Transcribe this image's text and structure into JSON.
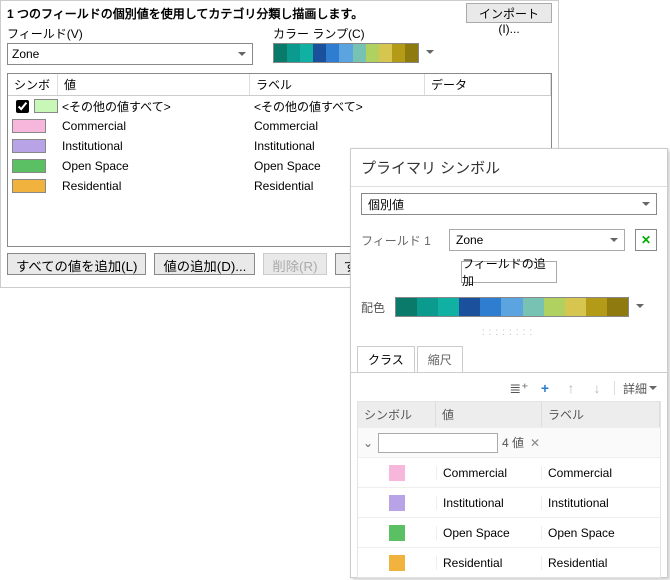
{
  "main": {
    "description": "1 つのフィールドの個別値を使用してカテゴリ分類し描画します。",
    "import_btn": "インポート(I)...",
    "field_label": "フィールド(V)",
    "field_value": "Zone",
    "ramp_label": "カラー ランプ(C)",
    "ramp_colors": [
      "#0a7a6a",
      "#0b9b8e",
      "#10b1a2",
      "#1a509c",
      "#2e7dd1",
      "#5ba4e0",
      "#77c2b2",
      "#b0d060",
      "#d6c54f",
      "#b39a17",
      "#8f7a10"
    ],
    "cols": {
      "symbol": "シンボ",
      "value": "値",
      "label": "ラベル",
      "data": "データ"
    },
    "rows": [
      {
        "checked": true,
        "color": "#c8f7b7",
        "value": "<その他の値すべて>",
        "label": "<その他の値すべて>"
      },
      {
        "color": "#f7b7dc",
        "value": "Commercial",
        "label": "Commercial"
      },
      {
        "color": "#b7a3e6",
        "value": "Institutional",
        "label": "Institutional"
      },
      {
        "color": "#5bbf63",
        "value": "Open Space",
        "label": "Open Space"
      },
      {
        "color": "#f2b23e",
        "value": "Residential",
        "label": "Residential"
      }
    ],
    "btns": {
      "add_all": "すべての値を追加(L)",
      "add": "値の追加(D)...",
      "remove": "削除(R)",
      "all": "すべ"
    }
  },
  "panel2": {
    "title": "プライマリ シンボル",
    "type_value": "個別値",
    "field1_label": "フィールド 1",
    "field1_value": "Zone",
    "x_icon": "✕",
    "add_field_btn": "フィールドの追加",
    "color_label": "配色",
    "ramp_colors": [
      "#0a7a6a",
      "#0b9b8e",
      "#10b1a2",
      "#1a509c",
      "#2e7dd1",
      "#5ba4e0",
      "#77c2b2",
      "#b0d060",
      "#d6c54f",
      "#b39a17",
      "#8f7a10"
    ],
    "tab_class": "クラス",
    "tab_scale": "縮尺",
    "more_label": "詳細",
    "cols": {
      "symbol": "シンボル",
      "value": "値",
      "label": "ラベル"
    },
    "group": {
      "count": "4 値",
      "x": "✕"
    },
    "rows": [
      {
        "color": "#f7b7dc",
        "value": "Commercial",
        "label": "Commercial"
      },
      {
        "color": "#b7a3e6",
        "value": "Institutional",
        "label": "Institutional"
      },
      {
        "color": "#5bbf63",
        "value": "Open Space",
        "label": "Open Space"
      },
      {
        "color": "#f2b23e",
        "value": "Residential",
        "label": "Residential"
      }
    ]
  }
}
